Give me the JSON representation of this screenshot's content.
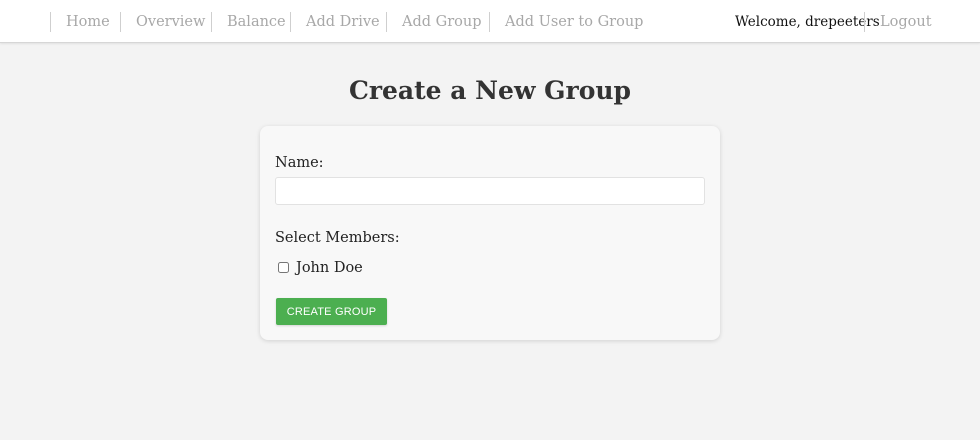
{
  "nav": {
    "items": [
      {
        "label": "Home"
      },
      {
        "label": "Overview"
      },
      {
        "label": "Balance"
      },
      {
        "label": "Add Drive"
      },
      {
        "label": "Add Group"
      },
      {
        "label": "Add User to Group"
      }
    ],
    "welcome_text": "Welcome, drepeeters",
    "logout_label": "Logout"
  },
  "page": {
    "title": "Create a New Group"
  },
  "form": {
    "name_label": "Name:",
    "name_value": "",
    "name_placeholder": "",
    "members_label": "Select Members:",
    "members": [
      {
        "name": "John Doe",
        "checked": false
      }
    ],
    "submit_label": "CREATE GROUP"
  },
  "colors": {
    "accent": "#4caf50",
    "background": "#f3f3f3",
    "nav_link": "#a8a8a8"
  }
}
